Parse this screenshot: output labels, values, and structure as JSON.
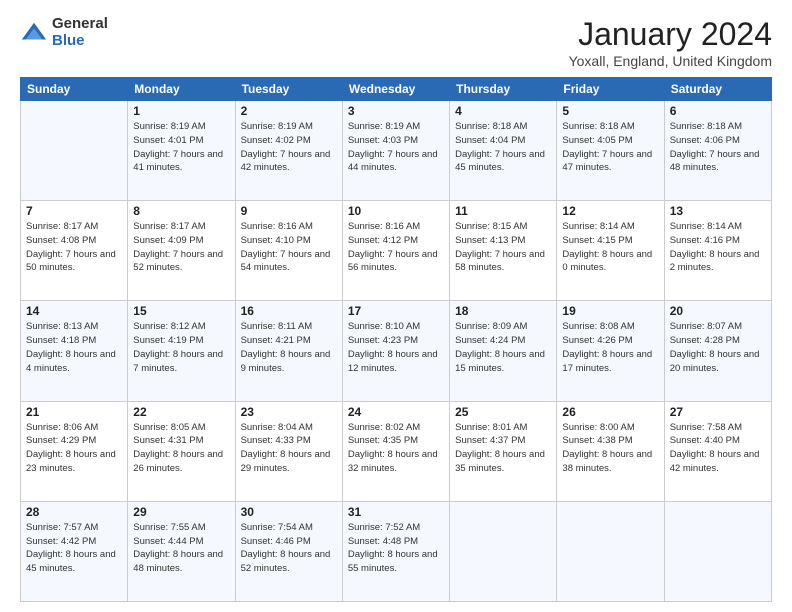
{
  "logo": {
    "general": "General",
    "blue": "Blue"
  },
  "header": {
    "month": "January 2024",
    "location": "Yoxall, England, United Kingdom"
  },
  "weekdays": [
    "Sunday",
    "Monday",
    "Tuesday",
    "Wednesday",
    "Thursday",
    "Friday",
    "Saturday"
  ],
  "weeks": [
    [
      {
        "day": "",
        "sunrise": "",
        "sunset": "",
        "daylight": ""
      },
      {
        "day": "1",
        "sunrise": "Sunrise: 8:19 AM",
        "sunset": "Sunset: 4:01 PM",
        "daylight": "Daylight: 7 hours and 41 minutes."
      },
      {
        "day": "2",
        "sunrise": "Sunrise: 8:19 AM",
        "sunset": "Sunset: 4:02 PM",
        "daylight": "Daylight: 7 hours and 42 minutes."
      },
      {
        "day": "3",
        "sunrise": "Sunrise: 8:19 AM",
        "sunset": "Sunset: 4:03 PM",
        "daylight": "Daylight: 7 hours and 44 minutes."
      },
      {
        "day": "4",
        "sunrise": "Sunrise: 8:18 AM",
        "sunset": "Sunset: 4:04 PM",
        "daylight": "Daylight: 7 hours and 45 minutes."
      },
      {
        "day": "5",
        "sunrise": "Sunrise: 8:18 AM",
        "sunset": "Sunset: 4:05 PM",
        "daylight": "Daylight: 7 hours and 47 minutes."
      },
      {
        "day": "6",
        "sunrise": "Sunrise: 8:18 AM",
        "sunset": "Sunset: 4:06 PM",
        "daylight": "Daylight: 7 hours and 48 minutes."
      }
    ],
    [
      {
        "day": "7",
        "sunrise": "Sunrise: 8:17 AM",
        "sunset": "Sunset: 4:08 PM",
        "daylight": "Daylight: 7 hours and 50 minutes."
      },
      {
        "day": "8",
        "sunrise": "Sunrise: 8:17 AM",
        "sunset": "Sunset: 4:09 PM",
        "daylight": "Daylight: 7 hours and 52 minutes."
      },
      {
        "day": "9",
        "sunrise": "Sunrise: 8:16 AM",
        "sunset": "Sunset: 4:10 PM",
        "daylight": "Daylight: 7 hours and 54 minutes."
      },
      {
        "day": "10",
        "sunrise": "Sunrise: 8:16 AM",
        "sunset": "Sunset: 4:12 PM",
        "daylight": "Daylight: 7 hours and 56 minutes."
      },
      {
        "day": "11",
        "sunrise": "Sunrise: 8:15 AM",
        "sunset": "Sunset: 4:13 PM",
        "daylight": "Daylight: 7 hours and 58 minutes."
      },
      {
        "day": "12",
        "sunrise": "Sunrise: 8:14 AM",
        "sunset": "Sunset: 4:15 PM",
        "daylight": "Daylight: 8 hours and 0 minutes."
      },
      {
        "day": "13",
        "sunrise": "Sunrise: 8:14 AM",
        "sunset": "Sunset: 4:16 PM",
        "daylight": "Daylight: 8 hours and 2 minutes."
      }
    ],
    [
      {
        "day": "14",
        "sunrise": "Sunrise: 8:13 AM",
        "sunset": "Sunset: 4:18 PM",
        "daylight": "Daylight: 8 hours and 4 minutes."
      },
      {
        "day": "15",
        "sunrise": "Sunrise: 8:12 AM",
        "sunset": "Sunset: 4:19 PM",
        "daylight": "Daylight: 8 hours and 7 minutes."
      },
      {
        "day": "16",
        "sunrise": "Sunrise: 8:11 AM",
        "sunset": "Sunset: 4:21 PM",
        "daylight": "Daylight: 8 hours and 9 minutes."
      },
      {
        "day": "17",
        "sunrise": "Sunrise: 8:10 AM",
        "sunset": "Sunset: 4:23 PM",
        "daylight": "Daylight: 8 hours and 12 minutes."
      },
      {
        "day": "18",
        "sunrise": "Sunrise: 8:09 AM",
        "sunset": "Sunset: 4:24 PM",
        "daylight": "Daylight: 8 hours and 15 minutes."
      },
      {
        "day": "19",
        "sunrise": "Sunrise: 8:08 AM",
        "sunset": "Sunset: 4:26 PM",
        "daylight": "Daylight: 8 hours and 17 minutes."
      },
      {
        "day": "20",
        "sunrise": "Sunrise: 8:07 AM",
        "sunset": "Sunset: 4:28 PM",
        "daylight": "Daylight: 8 hours and 20 minutes."
      }
    ],
    [
      {
        "day": "21",
        "sunrise": "Sunrise: 8:06 AM",
        "sunset": "Sunset: 4:29 PM",
        "daylight": "Daylight: 8 hours and 23 minutes."
      },
      {
        "day": "22",
        "sunrise": "Sunrise: 8:05 AM",
        "sunset": "Sunset: 4:31 PM",
        "daylight": "Daylight: 8 hours and 26 minutes."
      },
      {
        "day": "23",
        "sunrise": "Sunrise: 8:04 AM",
        "sunset": "Sunset: 4:33 PM",
        "daylight": "Daylight: 8 hours and 29 minutes."
      },
      {
        "day": "24",
        "sunrise": "Sunrise: 8:02 AM",
        "sunset": "Sunset: 4:35 PM",
        "daylight": "Daylight: 8 hours and 32 minutes."
      },
      {
        "day": "25",
        "sunrise": "Sunrise: 8:01 AM",
        "sunset": "Sunset: 4:37 PM",
        "daylight": "Daylight: 8 hours and 35 minutes."
      },
      {
        "day": "26",
        "sunrise": "Sunrise: 8:00 AM",
        "sunset": "Sunset: 4:38 PM",
        "daylight": "Daylight: 8 hours and 38 minutes."
      },
      {
        "day": "27",
        "sunrise": "Sunrise: 7:58 AM",
        "sunset": "Sunset: 4:40 PM",
        "daylight": "Daylight: 8 hours and 42 minutes."
      }
    ],
    [
      {
        "day": "28",
        "sunrise": "Sunrise: 7:57 AM",
        "sunset": "Sunset: 4:42 PM",
        "daylight": "Daylight: 8 hours and 45 minutes."
      },
      {
        "day": "29",
        "sunrise": "Sunrise: 7:55 AM",
        "sunset": "Sunset: 4:44 PM",
        "daylight": "Daylight: 8 hours and 48 minutes."
      },
      {
        "day": "30",
        "sunrise": "Sunrise: 7:54 AM",
        "sunset": "Sunset: 4:46 PM",
        "daylight": "Daylight: 8 hours and 52 minutes."
      },
      {
        "day": "31",
        "sunrise": "Sunrise: 7:52 AM",
        "sunset": "Sunset: 4:48 PM",
        "daylight": "Daylight: 8 hours and 55 minutes."
      },
      {
        "day": "",
        "sunrise": "",
        "sunset": "",
        "daylight": ""
      },
      {
        "day": "",
        "sunrise": "",
        "sunset": "",
        "daylight": ""
      },
      {
        "day": "",
        "sunrise": "",
        "sunset": "",
        "daylight": ""
      }
    ]
  ]
}
